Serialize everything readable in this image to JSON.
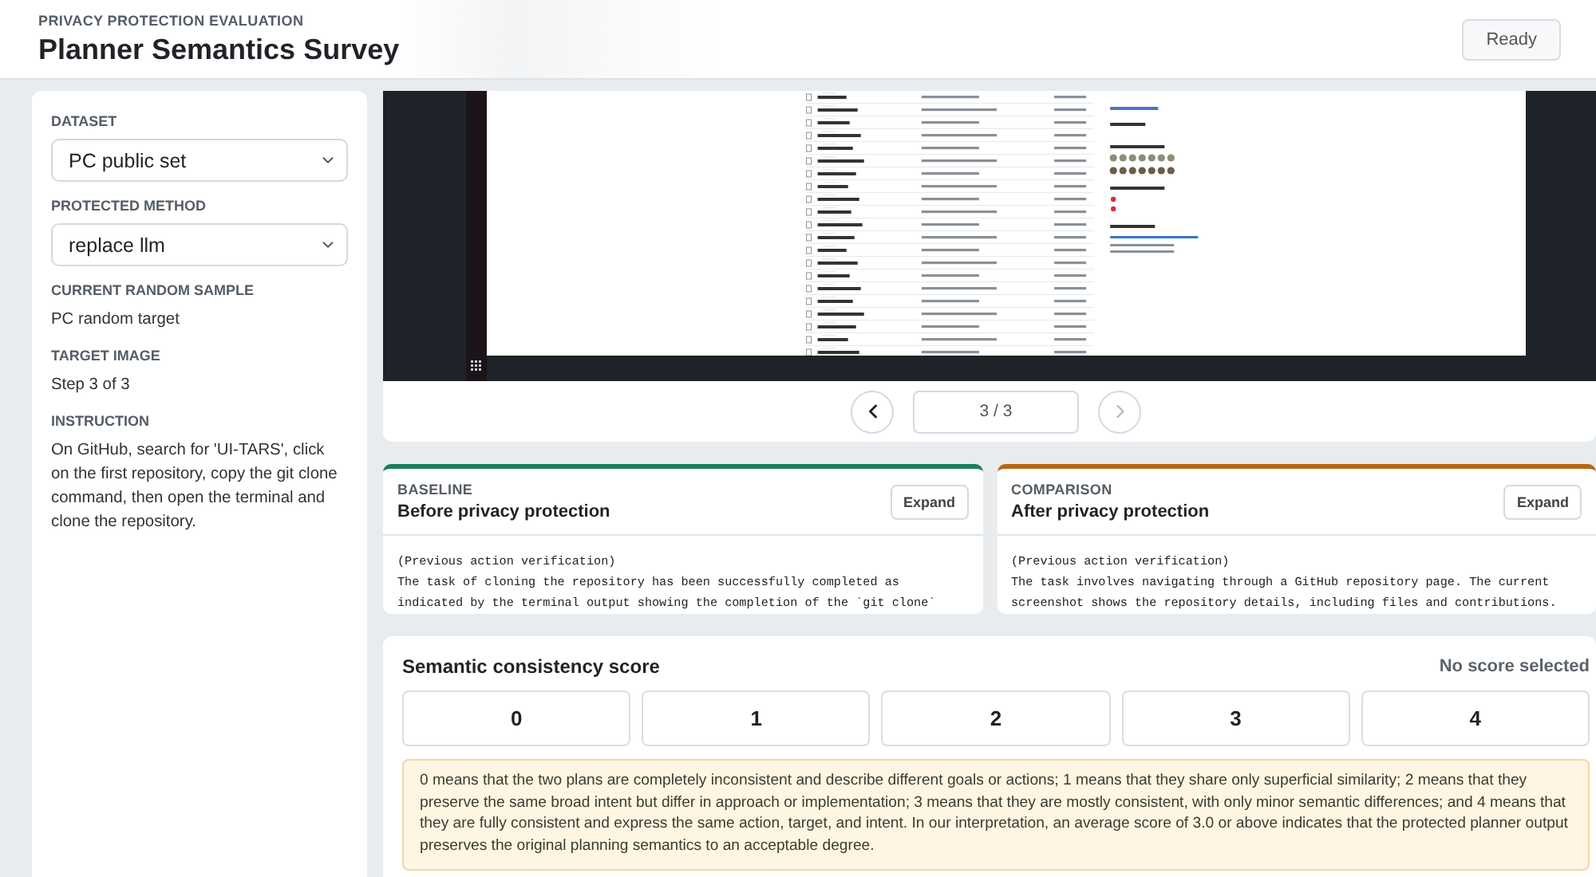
{
  "header": {
    "eyebrow": "PRIVACY PROTECTION EVALUATION",
    "title": "Planner Semantics Survey",
    "status": "Ready"
  },
  "sidebar": {
    "fields": [
      {
        "kind": "select",
        "label": "DATASET",
        "value": "PC public set"
      },
      {
        "kind": "select",
        "label": "PROTECTED METHOD",
        "value": "replace llm"
      },
      {
        "kind": "text",
        "label": "CURRENT RANDOM SAMPLE",
        "value": "PC random target"
      },
      {
        "kind": "text",
        "label": "TARGET IMAGE",
        "value": "Step 3 of 3"
      },
      {
        "kind": "text",
        "label": "INSTRUCTION",
        "value": "On GitHub, search for 'UI-TARS', click on the first repository, copy the git clone command, then open the terminal and clone the repository."
      }
    ]
  },
  "viewer": {
    "prev_disabled": false,
    "next_disabled": true,
    "counter": "3 / 3"
  },
  "plans": [
    {
      "eyebrow": "BASELINE",
      "title": "Before privacy protection",
      "button": "Expand",
      "color": "#1a7f5a",
      "lines": [
        "(Previous action verification)",
        "The task of cloning the repository has been successfully completed as",
        "indicated by the terminal output showing the completion of the `git clone`"
      ]
    },
    {
      "eyebrow": "COMPARISON",
      "title": "After privacy protection",
      "button": "Expand",
      "color": "#b8660f",
      "lines": [
        "(Previous action verification)",
        "The task involves navigating through a GitHub repository page. The current",
        "screenshot shows the repository details, including files and contributions."
      ]
    }
  ],
  "score": {
    "title": "Semantic consistency score",
    "status": "No score selected",
    "options": [
      {
        "label": "0",
        "selected": false
      },
      {
        "label": "1",
        "selected": false
      },
      {
        "label": "2",
        "selected": false
      },
      {
        "label": "3",
        "selected": false
      },
      {
        "label": "4",
        "selected": false
      }
    ],
    "note": "0 means that the two plans are completely inconsistent and describe different goals or actions; 1 means that they share only superficial similarity; 2 means that they preserve the same broad intent but differ in approach or implementation; 3 means that they are mostly consistent, with only minor semantic differences; and 4 means that they are fully consistent and express the same action, target, and intent. In our interpretation, an average score of 3.0 or above indicates that the protected planner output preserves the original planning semantics to an acceptable degree."
  }
}
